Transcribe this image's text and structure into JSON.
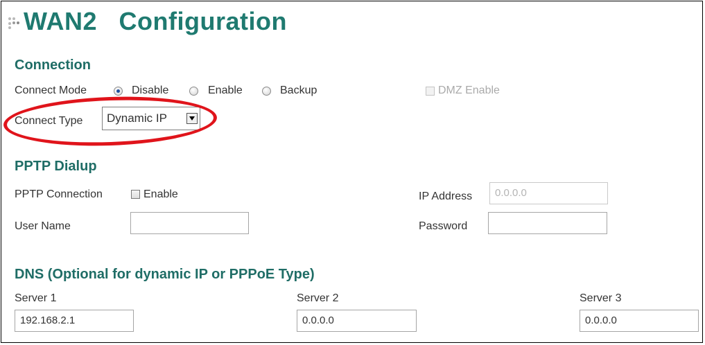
{
  "page": {
    "title": "WAN2   Configuration"
  },
  "connection": {
    "heading": "Connection",
    "connect_mode_label": "Connect Mode",
    "modes": [
      {
        "label": "Disable",
        "checked": true
      },
      {
        "label": "Enable",
        "checked": false
      },
      {
        "label": "Backup",
        "checked": false
      }
    ],
    "dmz_label": "DMZ Enable",
    "connect_type_label": "Connect Type",
    "connect_type_value": "Dynamic IP"
  },
  "pptp": {
    "heading": "PPTP Dialup",
    "connection_label": "PPTP Connection",
    "enable_label": "Enable",
    "ip_address_label": "IP Address",
    "ip_address_value": "0.0.0.0",
    "user_name_label": "User Name",
    "user_name_value": "",
    "password_label": "Password",
    "password_value": ""
  },
  "dns": {
    "heading": "DNS (Optional for dynamic IP or PPPoE Type)",
    "servers": [
      {
        "label": "Server 1",
        "value": "192.168.2.1"
      },
      {
        "label": "Server 2",
        "value": "0.0.0.0"
      },
      {
        "label": "Server 3",
        "value": "0.0.0.0"
      }
    ]
  },
  "colors": {
    "heading": "#1f6d66",
    "annotation_circle": "#e0141b"
  }
}
